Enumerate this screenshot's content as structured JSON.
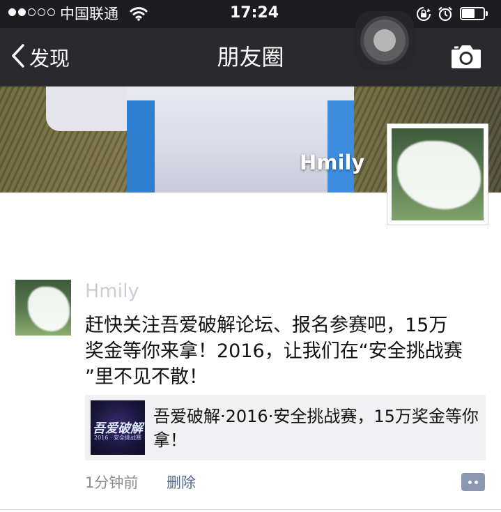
{
  "status_bar": {
    "carrier": "中国联通",
    "time": "17:24",
    "signal_bars": 2,
    "signal_total": 5,
    "battery_level": 0.6,
    "icons": [
      "wifi-icon",
      "orientation-lock-icon",
      "alarm-icon",
      "battery-icon"
    ]
  },
  "nav": {
    "back_label": "发现",
    "title": "朋友圈",
    "icons": [
      "chevron-left-icon",
      "camera-icon"
    ]
  },
  "cover": {
    "name": "Hmily"
  },
  "post": {
    "author": "Hmily",
    "text": "赶快关注吾爱破解论坛、报名参赛吧，15万\n奖金等你来拿！2016，让我们在“安全挑战赛\n”里不见不散！",
    "link": {
      "title": "吾爱破解·2016·安全挑战赛，15万奖金等你拿！",
      "thumb_title": "吾爱破解",
      "thumb_subtitle": "2016 · 安全挑战赛"
    },
    "time": "1分钟前",
    "delete_label": "删除"
  },
  "colors": {
    "status_bar_bg": "#1d1c20",
    "nav_bg": "#2a292e",
    "author_name": "#c9cdd6",
    "link_blue": "#56688f",
    "card_bg": "#f1f1f4",
    "comment_button": "#8b96b0"
  }
}
